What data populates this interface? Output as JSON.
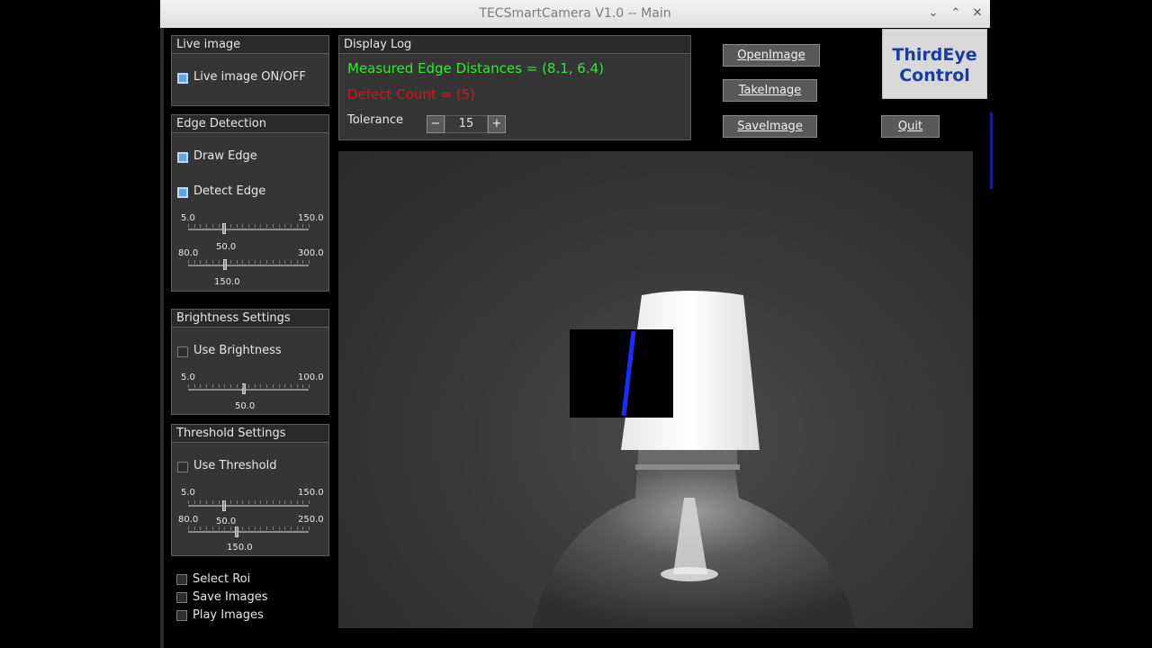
{
  "window": {
    "title": "TECSmartCamera V1.0 -- Main"
  },
  "live_image": {
    "header": "Live image",
    "checkbox_label": "Live image ON/OFF",
    "checked": true
  },
  "edge_detection": {
    "header": "Edge Detection",
    "draw_edge": {
      "label": "Draw Edge",
      "checked": true
    },
    "detect_edge": {
      "label": "Detect Edge",
      "checked": true
    },
    "slider1": {
      "min": "5.0",
      "max": "150.0",
      "value": "50.0"
    },
    "slider2": {
      "min": "80.0",
      "max": "300.0",
      "value": "150.0"
    }
  },
  "brightness": {
    "header": "Brightness Settings",
    "use": {
      "label": "Use Brightness",
      "checked": false
    },
    "slider": {
      "min": "5.0",
      "max": "100.0",
      "value": "50.0"
    }
  },
  "threshold": {
    "header": "Threshold Settings",
    "use": {
      "label": "Use Threshold",
      "checked": false
    },
    "slider1": {
      "min": "5.0",
      "max": "150.0",
      "value": "50.0"
    },
    "slider2": {
      "min": "80.0",
      "max": "250.0",
      "value": "150.0"
    }
  },
  "options": [
    {
      "label": "Select Roi",
      "checked": false
    },
    {
      "label": "Save Images",
      "checked": false
    },
    {
      "label": "Play Images",
      "checked": false
    }
  ],
  "display_log": {
    "header": "Display Log",
    "measured": "Measured Edge Distances = (8.1, 6.4)",
    "defect": "Defect Count = (5)",
    "tolerance_label": "Tolerance",
    "tolerance_value": "15",
    "minus": "−",
    "plus": "+"
  },
  "buttons": {
    "open": "OpenImage",
    "take": "TakeImage",
    "save": "SaveImage",
    "quit": "Quit"
  },
  "logo": {
    "line1": "ThirdEye",
    "line2": "Control"
  },
  "colors": {
    "measured": "#2ee82e",
    "defect": "#e01010",
    "edge_line": "#1a2cff",
    "logo_text": "#1a3ea0"
  }
}
